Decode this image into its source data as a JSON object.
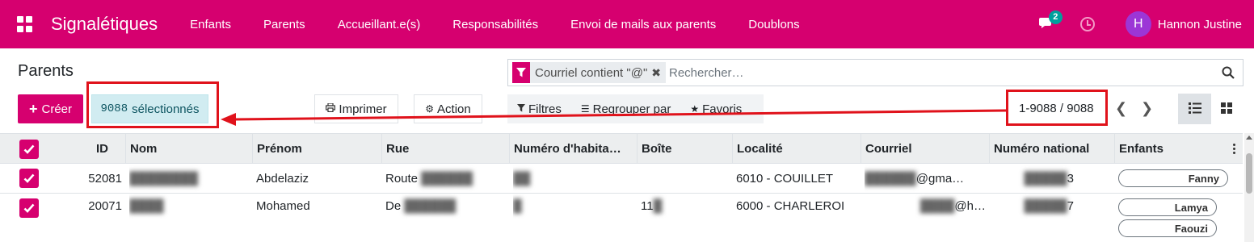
{
  "navbar": {
    "brand": "Signalétiques",
    "menu": [
      "Enfants",
      "Parents",
      "Accueillant.e(s)",
      "Responsabilités",
      "Envoi de mails aux parents",
      "Doublons"
    ],
    "chat_badge": "2",
    "avatar_initial": "H",
    "user_name": "Hannon Justine",
    "accent_color": "#d6006f"
  },
  "control": {
    "title": "Parents",
    "facet_label": "Courriel contient \"@\"",
    "facet_close": "✖",
    "search_placeholder": "Rechercher…",
    "create_label": "Créer",
    "selected_count": "9088",
    "selected_label": "sélectionnés",
    "print_label": "Imprimer",
    "action_label": "Action",
    "filters_label": "Filtres",
    "group_label": "Regrouper par",
    "favorites_label": "Favoris",
    "pager": "1-9088 / 9088",
    "pager_prev": "❮",
    "pager_next": "❯"
  },
  "table": {
    "columns": [
      "ID",
      "Nom",
      "Prénom",
      "Rue",
      "Numéro d'habita…",
      "Boîte",
      "Localité",
      "Courriel",
      "Numéro national",
      "Enfants"
    ],
    "rows": [
      {
        "id": "52081",
        "nom": "",
        "prenom": "Abdelaziz",
        "rue": "Route",
        "numero": "",
        "boite": "",
        "localite": "6010 - COUILLET",
        "courriel": "@gma…",
        "national": "3",
        "enfants": [
          "Fanny"
        ]
      },
      {
        "id": "20071",
        "nom": "",
        "prenom": "Mohamed",
        "rue": "De",
        "numero": "",
        "boite": "11",
        "localite": "6000 - CHARLEROI",
        "courriel": "@h…",
        "national": "7",
        "enfants": [
          "Lamya",
          "Faouzi"
        ]
      }
    ]
  },
  "annotations": {
    "highlight_color": "#e0121b"
  }
}
